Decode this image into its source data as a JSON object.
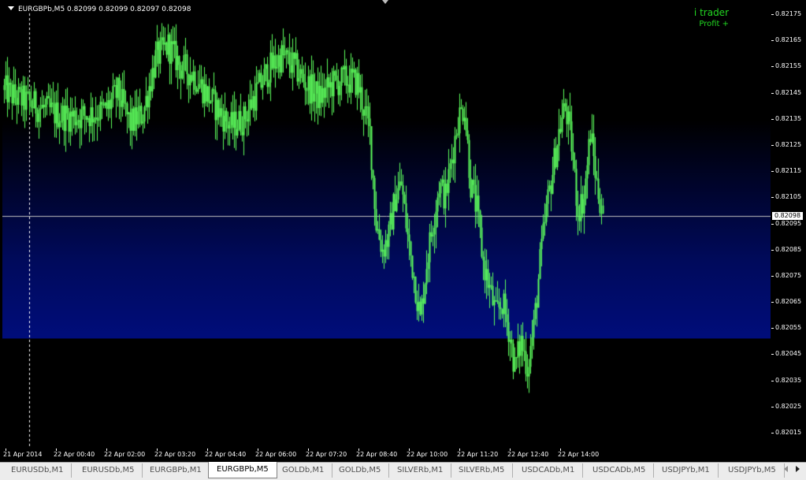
{
  "chart": {
    "symbol_line": "EURGBPb,M5  0.82099 0.82099 0.82097 0.82098",
    "current_price": "0.82098",
    "current_price_value": 0.82098
  },
  "brand": {
    "name": "i trader",
    "subtitle": "Profit +"
  },
  "colors": {
    "candle": "#5dff5d",
    "price_line": "#c0c0c0",
    "text": "#ffffff",
    "band": "#000d7a"
  },
  "price_axis": {
    "labels": [
      "0.82175",
      "0.82165",
      "0.82155",
      "0.82145",
      "0.82135",
      "0.82125",
      "0.82115",
      "0.82105",
      "0.82095",
      "0.82085",
      "0.82075",
      "0.82065",
      "0.82055",
      "0.82045",
      "0.82035",
      "0.82025",
      "0.82015"
    ],
    "min": 0.8201,
    "max": 0.8218
  },
  "time_axis": {
    "labels": [
      "21 Apr 2014",
      "22 Apr 00:40",
      "22 Apr 02:00",
      "22 Apr 03:20",
      "22 Apr 04:40",
      "22 Apr 06:00",
      "22 Apr 07:20",
      "22 Apr 08:40",
      "22 Apr 10:00",
      "22 Apr 11:20",
      "22 Apr 12:40",
      "22 Apr 14:00"
    ]
  },
  "chart_data": {
    "type": "line",
    "series": [
      {
        "x": [
          0,
          16,
          32,
          48,
          64,
          80,
          96,
          112,
          128,
          144,
          160,
          176,
          192,
          208,
          224,
          240,
          256,
          272,
          288,
          304,
          320,
          336,
          352,
          368,
          384,
          400,
          416,
          432,
          448,
          464,
          472,
          480,
          488,
          496,
          504,
          512,
          520,
          528,
          536,
          544,
          552,
          560,
          568,
          576,
          584,
          592,
          600,
          608,
          616,
          624,
          632,
          640,
          648,
          656,
          664,
          672,
          680,
          688,
          696,
          704,
          712,
          720,
          728,
          736,
          744,
          752,
          760
        ],
        "values": [
          0.82146,
          0.82143,
          0.82141,
          0.82139,
          0.82137,
          0.82136,
          0.82136,
          0.82137,
          0.82138,
          0.82145,
          0.82133,
          0.82137,
          0.82158,
          0.82163,
          0.82155,
          0.82152,
          0.82145,
          0.82138,
          0.82132,
          0.82135,
          0.82145,
          0.82154,
          0.82159,
          0.82155,
          0.82148,
          0.82143,
          0.82148,
          0.8215,
          0.82149,
          0.8213,
          0.82095,
          0.82085,
          0.8209,
          0.82105,
          0.8211,
          0.8209,
          0.82075,
          0.82058,
          0.8208,
          0.82095,
          0.8211,
          0.82105,
          0.8212,
          0.82135,
          0.8214,
          0.8211,
          0.821,
          0.8208,
          0.8207,
          0.8206,
          0.82065,
          0.82055,
          0.8204,
          0.8205,
          0.8204,
          0.82055,
          0.8208,
          0.821,
          0.82115,
          0.8213,
          0.8214,
          0.82125,
          0.821,
          0.82105,
          0.8213,
          0.8211,
          0.82098
        ]
      }
    ],
    "ylim": [
      0.8201,
      0.8218
    ],
    "current_price": 0.82098,
    "grid": false
  },
  "tabs": [
    {
      "label": "EURUSDb,M1",
      "active": false
    },
    {
      "label": "EURUSDb,M5",
      "active": false
    },
    {
      "label": "EURGBPb,M1",
      "active": false
    },
    {
      "label": "EURGBPb,M5",
      "active": true
    },
    {
      "label": "GOLDb,M1",
      "active": false
    },
    {
      "label": "GOLDb,M5",
      "active": false
    },
    {
      "label": "SILVERb,M1",
      "active": false
    },
    {
      "label": "SILVERb,M5",
      "active": false
    },
    {
      "label": "USDCADb,M1",
      "active": false
    },
    {
      "label": "USDCADb,M5",
      "active": false
    },
    {
      "label": "USDJPYb,M1",
      "active": false
    },
    {
      "label": "USDJPYb,M5",
      "active": false
    }
  ],
  "tab_nav": {
    "prev_icon": "triangle-left",
    "next_icon": "triangle-right"
  }
}
